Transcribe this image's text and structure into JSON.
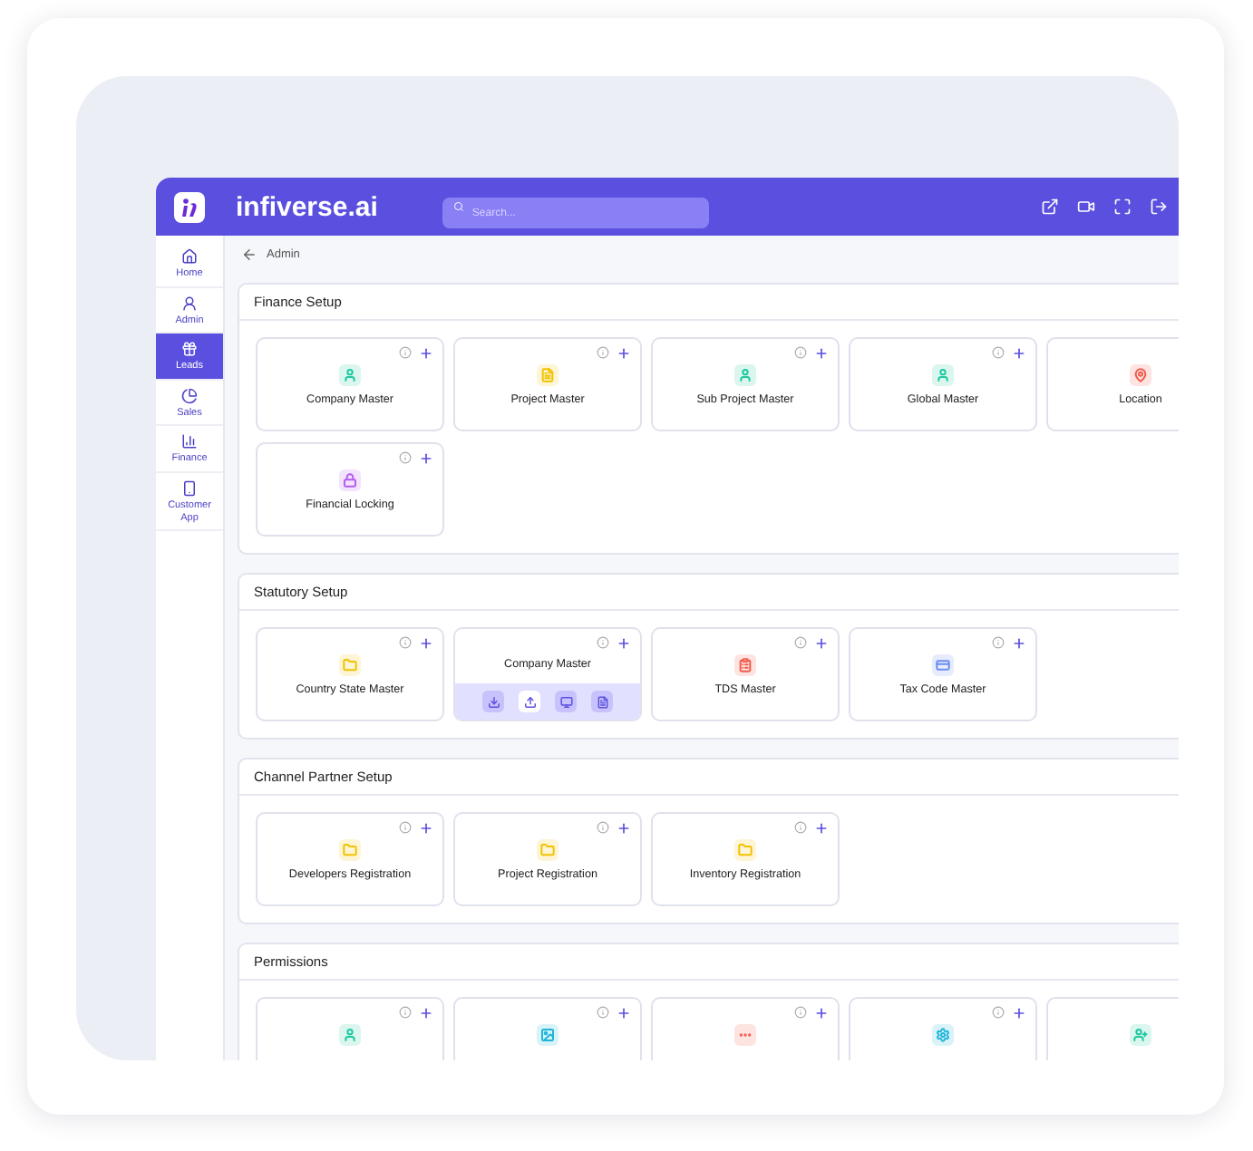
{
  "header": {
    "title": "infiverse.ai",
    "search": {
      "placeholder": "Search..."
    }
  },
  "sidebar": {
    "items": [
      {
        "label": "Home",
        "kind": "home",
        "selected": false
      },
      {
        "label": "Admin",
        "kind": "admin",
        "selected": false
      },
      {
        "label": "Leads",
        "kind": "leads",
        "selected": true
      },
      {
        "label": "Sales",
        "kind": "sales",
        "selected": false
      },
      {
        "label": "Finance",
        "kind": "finance",
        "selected": false
      },
      {
        "label": "Customer App",
        "kind": "app",
        "selected": false
      }
    ]
  },
  "breadcrumb": "Admin",
  "sections": [
    {
      "title": "Finance Setup",
      "cards": [
        {
          "label": "Company Master",
          "kind": "person",
          "color": "#1ec9a0"
        },
        {
          "label": "Project Master",
          "kind": "document",
          "color": "#f2c200"
        },
        {
          "label": "Sub Project Master",
          "kind": "person",
          "color": "#1ec9a0"
        },
        {
          "label": "Global Master",
          "kind": "person",
          "color": "#1ec9a0"
        },
        {
          "label": "Location",
          "kind": "pin",
          "color": "#f25a4a"
        },
        {
          "label": "Financial Locking",
          "kind": "lock",
          "color": "#b45cf0"
        }
      ]
    },
    {
      "title": "Statutory Setup",
      "cards": [
        {
          "label": "Country State Master",
          "kind": "folder",
          "color": "#f2c200"
        },
        {
          "label": "Company Master",
          "actions": [
            {
              "kind": "download",
              "selected": false
            },
            {
              "kind": "upload",
              "selected": true
            },
            {
              "kind": "screen",
              "selected": false
            },
            {
              "kind": "document",
              "selected": false
            }
          ]
        },
        {
          "label": "TDS Master",
          "kind": "report",
          "color": "#f25a4a"
        },
        {
          "label": "Tax Code Master",
          "kind": "card",
          "color": "#6d8cf5"
        }
      ]
    },
    {
      "title": "Channel Partner Setup",
      "cards": [
        {
          "label": "Developers Registration",
          "kind": "folder",
          "color": "#f2c200"
        },
        {
          "label": "Project Registration",
          "kind": "folder",
          "color": "#f2c200"
        },
        {
          "label": "Inventory Registration",
          "kind": "folder",
          "color": "#f2c200"
        }
      ]
    },
    {
      "title": "Permissions",
      "cards": [
        {
          "kind": "person",
          "color": "#1ec9a0"
        },
        {
          "kind": "image",
          "color": "#1fb5d8"
        },
        {
          "kind": "dots",
          "color": "#f25a4a"
        },
        {
          "kind": "gear",
          "color": "#1fb5d8"
        },
        {
          "kind": "useradd",
          "color": "#1ec9a0"
        }
      ]
    }
  ]
}
